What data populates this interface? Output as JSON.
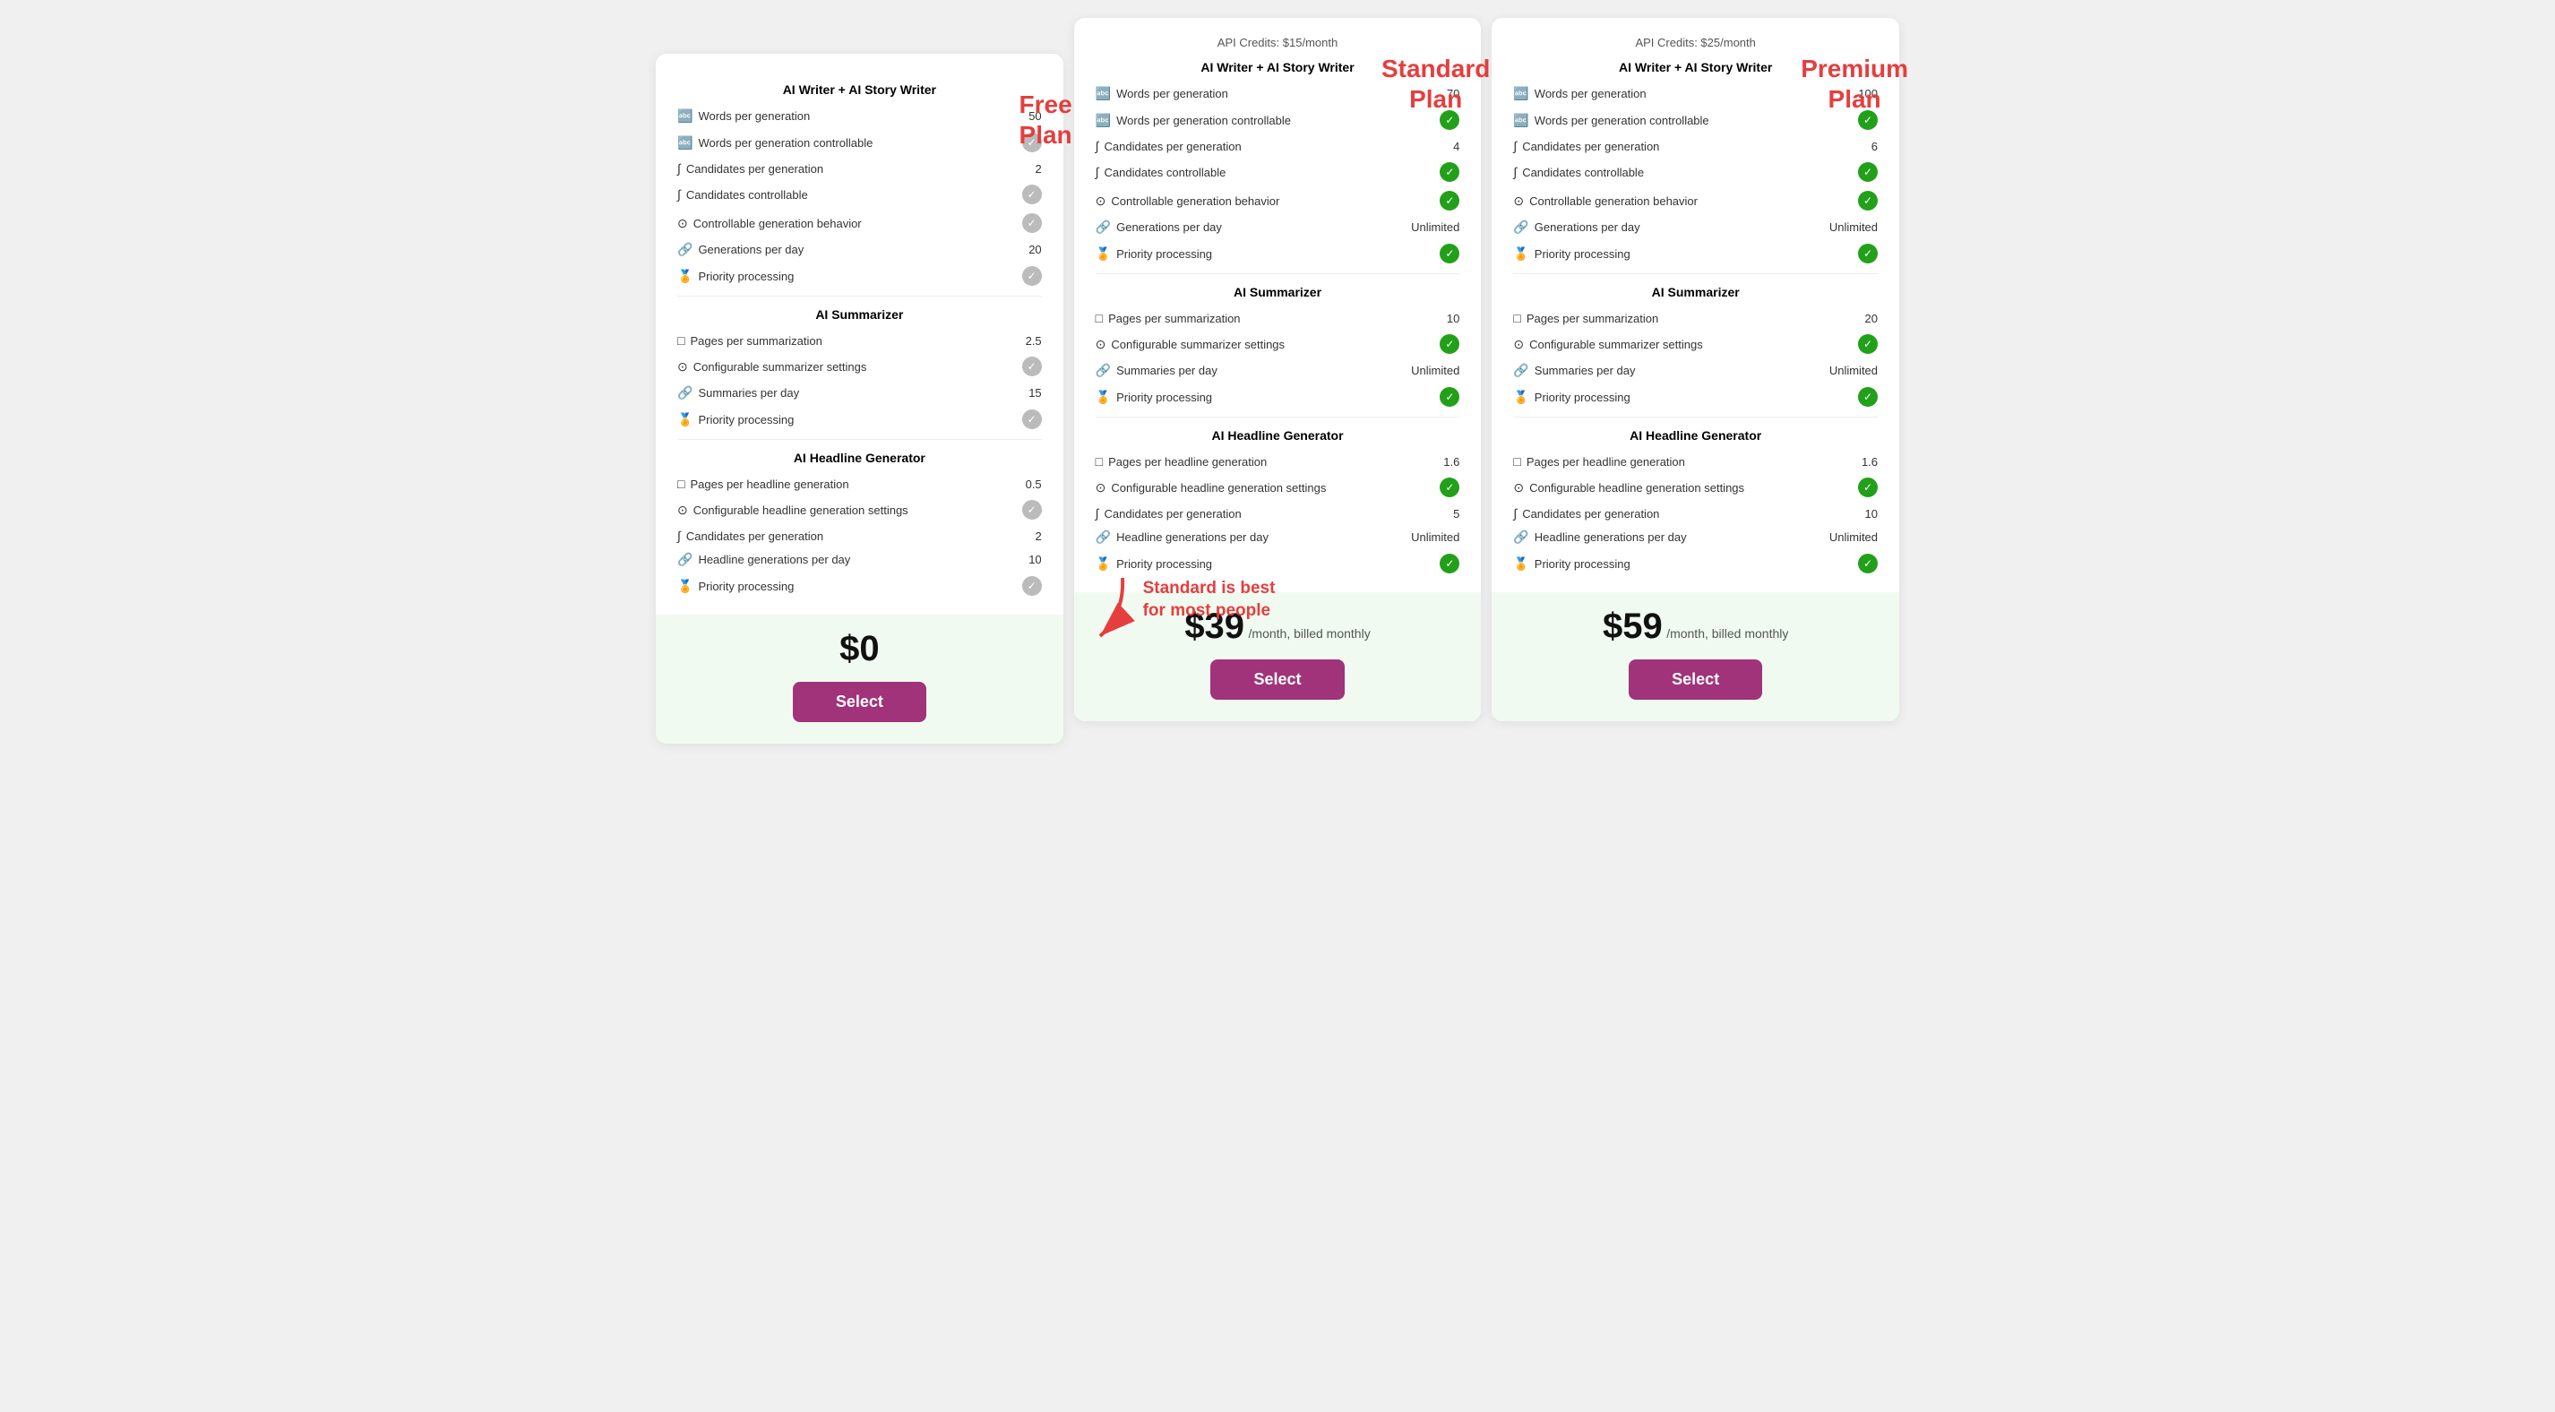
{
  "plans": [
    {
      "id": "free",
      "name": "Free Plan",
      "api_credits": null,
      "price": "$0",
      "price_detail": "",
      "button_label": "Select",
      "sections": [
        {
          "title": "AI Writer + AI Story Writer",
          "features": [
            {
              "icon": "🔤",
              "label": "Words per generation",
              "value": "50",
              "type": "number"
            },
            {
              "icon": "🔤",
              "label": "Words per generation controllable",
              "value": null,
              "type": "gray-check"
            },
            {
              "icon": "∫",
              "label": "Candidates per generation",
              "value": "2",
              "type": "number"
            },
            {
              "icon": "∫",
              "label": "Candidates controllable",
              "value": null,
              "type": "gray-check"
            },
            {
              "icon": "⊙",
              "label": "Controllable generation behavior",
              "value": null,
              "type": "gray-check"
            },
            {
              "icon": "🔗",
              "label": "Generations per day",
              "value": "20",
              "type": "number"
            },
            {
              "icon": "🏅",
              "label": "Priority processing",
              "value": null,
              "type": "gray-check"
            }
          ]
        },
        {
          "title": "AI Summarizer",
          "features": [
            {
              "icon": "□",
              "label": "Pages per summarization",
              "value": "2.5",
              "type": "number"
            },
            {
              "icon": "⊙",
              "label": "Configurable summarizer settings",
              "value": null,
              "type": "gray-check"
            },
            {
              "icon": "🔗",
              "label": "Summaries per day",
              "value": "15",
              "type": "number"
            },
            {
              "icon": "🏅",
              "label": "Priority processing",
              "value": null,
              "type": "gray-check"
            }
          ]
        },
        {
          "title": "AI Headline Generator",
          "features": [
            {
              "icon": "□",
              "label": "Pages per headline generation",
              "value": "0.5",
              "type": "number"
            },
            {
              "icon": "⊙",
              "label": "Configurable headline generation settings",
              "value": null,
              "type": "gray-check"
            },
            {
              "icon": "∫",
              "label": "Candidates per generation",
              "value": "2",
              "type": "number"
            },
            {
              "icon": "🔗",
              "label": "Headline generations per day",
              "value": "10",
              "type": "number"
            },
            {
              "icon": "🏅",
              "label": "Priority processing",
              "value": null,
              "type": "gray-check"
            }
          ]
        }
      ]
    },
    {
      "id": "standard",
      "name": "Standard Plan",
      "api_credits": "API Credits: $15/month",
      "price": "$39",
      "price_detail": "/month, billed monthly",
      "button_label": "Select",
      "sections": [
        {
          "title": "AI Writer + AI Story Writer",
          "features": [
            {
              "icon": "🔤",
              "label": "Words per generation",
              "value": "70",
              "type": "number"
            },
            {
              "icon": "🔤",
              "label": "Words per generation controllable",
              "value": null,
              "type": "green-check"
            },
            {
              "icon": "∫",
              "label": "Candidates per generation",
              "value": "4",
              "type": "number"
            },
            {
              "icon": "∫",
              "label": "Candidates controllable",
              "value": null,
              "type": "green-check"
            },
            {
              "icon": "⊙",
              "label": "Controllable generation behavior",
              "value": null,
              "type": "green-check"
            },
            {
              "icon": "🔗",
              "label": "Generations per day",
              "value": "Unlimited",
              "type": "text"
            },
            {
              "icon": "🏅",
              "label": "Priority processing",
              "value": null,
              "type": "green-check"
            }
          ]
        },
        {
          "title": "AI Summarizer",
          "features": [
            {
              "icon": "□",
              "label": "Pages per summarization",
              "value": "10",
              "type": "number"
            },
            {
              "icon": "⊙",
              "label": "Configurable summarizer settings",
              "value": null,
              "type": "green-check"
            },
            {
              "icon": "🔗",
              "label": "Summaries per day",
              "value": "Unlimited",
              "type": "text"
            },
            {
              "icon": "🏅",
              "label": "Priority processing",
              "value": null,
              "type": "green-check"
            }
          ]
        },
        {
          "title": "AI Headline Generator",
          "features": [
            {
              "icon": "□",
              "label": "Pages per headline generation",
              "value": "1.6",
              "type": "number"
            },
            {
              "icon": "⊙",
              "label": "Configurable headline generation settings",
              "value": null,
              "type": "green-check"
            },
            {
              "icon": "∫",
              "label": "Candidates per generation",
              "value": "5",
              "type": "number"
            },
            {
              "icon": "🔗",
              "label": "Headline generations per day",
              "value": "Unlimited",
              "type": "text"
            },
            {
              "icon": "🏅",
              "label": "Priority processing",
              "value": null,
              "type": "green-check"
            }
          ]
        }
      ]
    },
    {
      "id": "premium",
      "name": "Premium Plan",
      "api_credits": "API Credits: $25/month",
      "price": "$59",
      "price_detail": "/month, billed monthly",
      "button_label": "Select",
      "sections": [
        {
          "title": "AI Writer + AI Story Writer",
          "features": [
            {
              "icon": "🔤",
              "label": "Words per generation",
              "value": "100",
              "type": "number"
            },
            {
              "icon": "🔤",
              "label": "Words per generation controllable",
              "value": null,
              "type": "green-check"
            },
            {
              "icon": "∫",
              "label": "Candidates per generation",
              "value": "6",
              "type": "number"
            },
            {
              "icon": "∫",
              "label": "Candidates controllable",
              "value": null,
              "type": "green-check"
            },
            {
              "icon": "⊙",
              "label": "Controllable generation behavior",
              "value": null,
              "type": "green-check"
            },
            {
              "icon": "🔗",
              "label": "Generations per day",
              "value": "Unlimited",
              "type": "text"
            },
            {
              "icon": "🏅",
              "label": "Priority processing",
              "value": null,
              "type": "green-check"
            }
          ]
        },
        {
          "title": "AI Summarizer",
          "features": [
            {
              "icon": "□",
              "label": "Pages per summarization",
              "value": "20",
              "type": "number"
            },
            {
              "icon": "⊙",
              "label": "Configurable summarizer settings",
              "value": null,
              "type": "green-check"
            },
            {
              "icon": "🔗",
              "label": "Summaries per day",
              "value": "Unlimited",
              "type": "text"
            },
            {
              "icon": "🏅",
              "label": "Priority processing",
              "value": null,
              "type": "green-check"
            }
          ]
        },
        {
          "title": "AI Headline Generator",
          "features": [
            {
              "icon": "□",
              "label": "Pages per headline generation",
              "value": "1.6",
              "type": "number"
            },
            {
              "icon": "⊙",
              "label": "Configurable headline generation settings",
              "value": null,
              "type": "green-check"
            },
            {
              "icon": "∫",
              "label": "Candidates per generation",
              "value": "10",
              "type": "number"
            },
            {
              "icon": "🔗",
              "label": "Headline generations per day",
              "value": "Unlimited",
              "type": "text"
            },
            {
              "icon": "🏅",
              "label": "Priority processing",
              "value": null,
              "type": "green-check"
            }
          ]
        }
      ]
    }
  ],
  "annotation": {
    "text": "Standard is best\nfor most people"
  }
}
